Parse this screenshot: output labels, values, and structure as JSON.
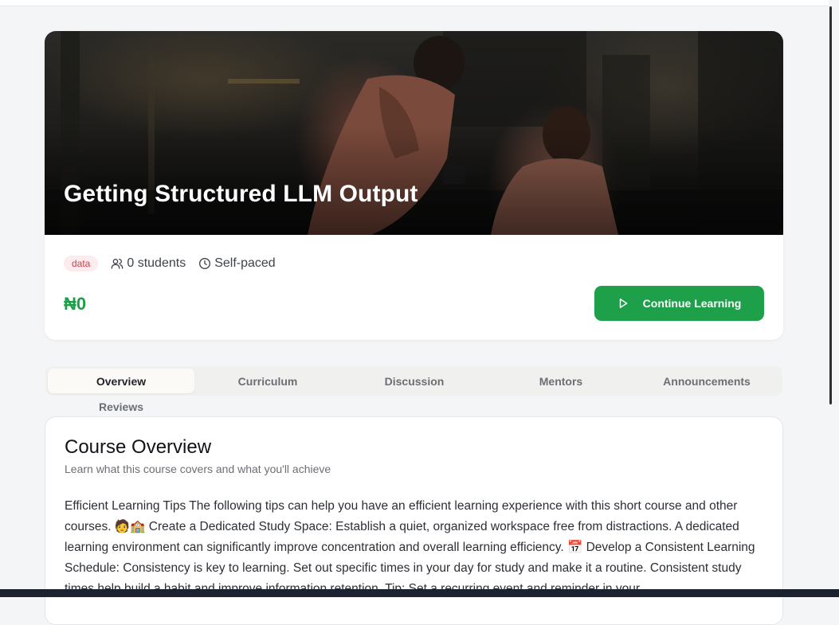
{
  "course": {
    "title": "Getting Structured LLM Output",
    "tag": "data",
    "students": "0 students",
    "pace": "Self-paced",
    "price": "₦0",
    "cta_label": "Continue Learning"
  },
  "tabs": [
    {
      "label": "Overview",
      "active": true
    },
    {
      "label": "Curriculum",
      "active": false
    },
    {
      "label": "Discussion",
      "active": false
    },
    {
      "label": "Mentors",
      "active": false
    },
    {
      "label": "Announcements",
      "active": false
    },
    {
      "label": "Reviews",
      "active": false
    }
  ],
  "overview": {
    "title": "Course Overview",
    "subtitle": "Learn what this course covers and what you'll achieve",
    "body": "Efficient Learning Tips The following tips can help you have an efficient learning experience with this short course and other courses. 🧑🏫 Create a Dedicated Study Space: Establish a quiet, organized workspace free from distractions. A dedicated learning environment can significantly improve concentration and overall learning efficiency. 📅 Develop a Consistent Learning Schedule: Consistency is key to learning. Set out specific times in your day for study and make it a routine. Consistent study times help build a habit and improve information retention. Tip: Set a recurring event and reminder in your"
  },
  "colors": {
    "accent": "#1ea04b",
    "price": "#1e9e4a",
    "tag_text": "#d43b4f",
    "tag_bg": "#fdecee"
  },
  "icons": {
    "students": "users-icon",
    "pace": "clock-icon",
    "cta": "play-icon"
  }
}
